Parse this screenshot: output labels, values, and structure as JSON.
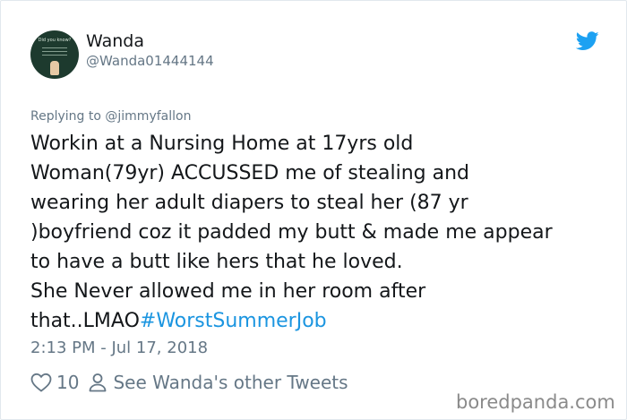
{
  "tweet": {
    "author_name": "Wanda",
    "author_handle": "@Wanda01444144",
    "avatar_text": "Did you know?",
    "replying_prefix": "Replying to",
    "replying_to": "@jimmyfallon",
    "body_lines": [
      "Workin at a Nursing Home at 17yrs old",
      "Woman(79yr) ACCUSSED me of stealing and",
      "wearing her adult diapers to steal her (87 yr",
      ")boyfriend coz it padded my butt & made me appear",
      "to have a butt like hers that he loved.",
      "She Never allowed me in her room after",
      "that..LMAO"
    ],
    "hashtag": "#WorstSummerJob",
    "timestamp": "2:13 PM - Jul 17, 2018",
    "like_count": "10",
    "other_tweets_label": "See Wanda's other Tweets"
  },
  "watermark": "boredpanda.com",
  "icons": {
    "brand": "twitter-bird-icon",
    "like": "heart-icon",
    "profile": "person-icon"
  },
  "colors": {
    "twitter_blue": "#1da1f2",
    "hashtag": "#1b95e0",
    "secondary_text": "#657786",
    "primary_text": "#14171a"
  }
}
